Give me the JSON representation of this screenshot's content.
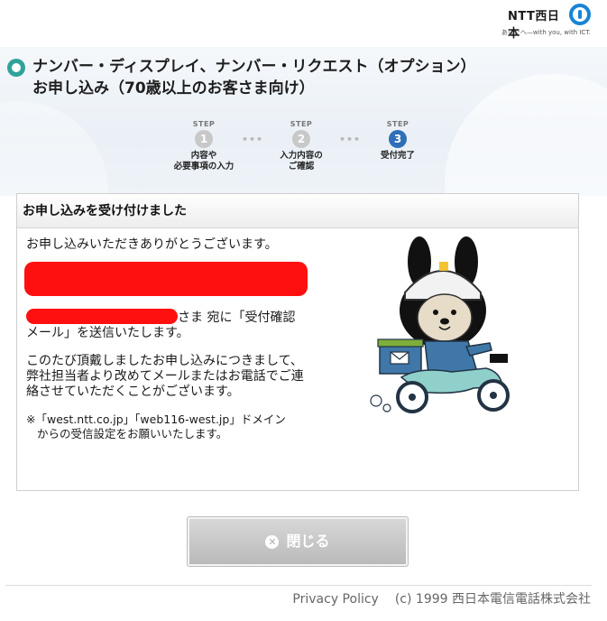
{
  "brand": {
    "logo_text": "NTT西日本",
    "tagline": "あしたへ—with you, with ICT."
  },
  "page": {
    "title_line1": "ナンバー・ディスプレイ、ナンバー・リクエスト（オプション）",
    "title_line2": "お申し込み（70歳以上のお客さま向け）"
  },
  "steps": [
    {
      "label": "STEP",
      "number": "1",
      "name": "内容や\n必要事項の入力",
      "state": "done"
    },
    {
      "label": "STEP",
      "number": "2",
      "name": "入力内容の\nご確認",
      "state": "done"
    },
    {
      "label": "STEP",
      "number": "3",
      "name": "受付完了",
      "state": "active"
    }
  ],
  "step_separator": "•••",
  "panel": {
    "heading": "お申し込みを受け付けました",
    "thanks": "お申し込みいただきありがとうございます。",
    "sent_text": "さま 宛に「受付確認メール」を送信いたします。",
    "contact_text": "このたび頂戴しましたお申し込みにつきまして、弊社担当者より改めてメールまたはお電話でご連絡させていただくことがございます。",
    "note_line1": "※「west.ntt.co.jp」「web116-west.jp」ドメイン",
    "note_line2": "からの受信設定をお願いいたします。"
  },
  "buttons": {
    "close_label": "閉じる",
    "close_icon": "close-circle-icon"
  },
  "footer": {
    "privacy": "Privacy Policy",
    "copyright": "(c) 1999 西日本電信電話株式会社"
  },
  "colors": {
    "accent": "#2fa39a",
    "step_active": "#2f6fb7",
    "redaction": "#ff1010",
    "logo_blue": "#1a84d6"
  }
}
